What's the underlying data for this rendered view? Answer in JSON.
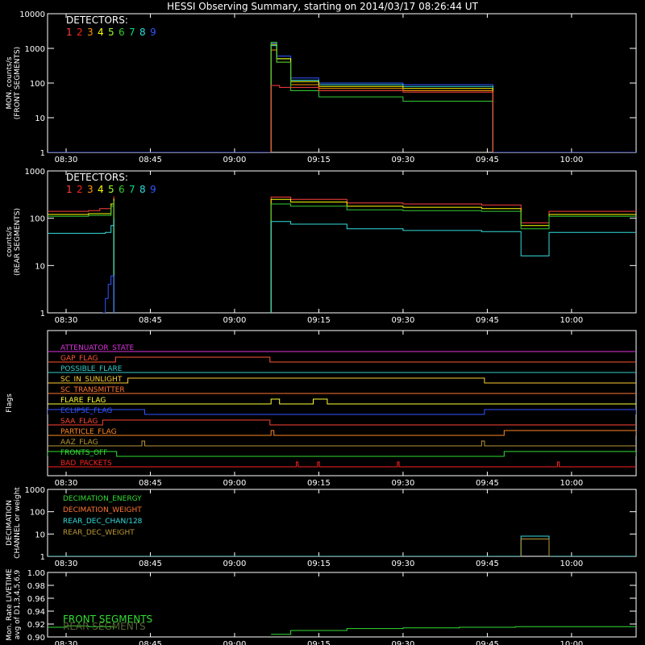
{
  "chart_data": {
    "title": "HESSI Observing Summary, starting on 2014/03/17 08:26:44 UT",
    "time_ticks": [
      "08:30",
      "08:45",
      "09:00",
      "09:15",
      "09:30",
      "09:45",
      "10:00"
    ],
    "time_tick_minutes": [
      30,
      45,
      60,
      75,
      90,
      105,
      120
    ],
    "x_range_minutes": [
      26.7,
      131.5
    ],
    "panels": [
      {
        "type": "line",
        "ylabel": [
          "MON. counts/s",
          "(FRONT SEGMENTS)"
        ],
        "yscale": "log",
        "ylim": [
          1,
          10000
        ],
        "y_tick_labels": [
          "1",
          "10",
          "100",
          "1000",
          "10000"
        ],
        "legend_title": "DETECTORS:",
        "legend_digits": [
          "1",
          "2",
          "3",
          "4",
          "5",
          "6",
          "7",
          "8",
          "9"
        ],
        "legend_colors": [
          "#ff4040",
          "#ff2020",
          "#ff9900",
          "#ffff00",
          "#99ff33",
          "#33cc33",
          "#00dd88",
          "#33dddd",
          "#3355ff"
        ],
        "series": [
          {
            "color": "#3355ff",
            "x": [
              26.7,
              66.5,
              66.5,
              67.5,
              70,
              75,
              90,
              106,
              106,
              131.5
            ],
            "y": [
              1,
              1,
              1400,
              600,
              140,
              100,
              90,
              90,
              1,
              1
            ]
          },
          {
            "color": "#33dddd",
            "x": [
              66.5,
              66.5,
              67.5,
              70,
              75,
              90,
              106,
              106
            ],
            "y": [
              1,
              1200,
              500,
              120,
              90,
              80,
              80,
              1
            ]
          },
          {
            "color": "#ffff00",
            "x": [
              66.5,
              66.5,
              67.5,
              70,
              75,
              90,
              106,
              106
            ],
            "y": [
              1,
              1300,
              500,
              110,
              80,
              70,
              70,
              1
            ]
          },
          {
            "color": "#ff9900",
            "x": [
              66.5,
              66.5,
              67.5,
              70,
              75,
              90,
              106,
              106
            ],
            "y": [
              1,
              900,
              400,
              90,
              70,
              60,
              60,
              1
            ]
          },
          {
            "color": "#33cc33",
            "x": [
              66.5,
              66.5,
              67.5,
              70,
              75,
              90,
              106,
              106
            ],
            "y": [
              1,
              1500,
              400,
              60,
              40,
              30,
              35,
              1
            ]
          },
          {
            "color": "#ff4040",
            "x": [
              66.5,
              66.5,
              68,
              75,
              90,
              106,
              106
            ],
            "y": [
              1,
              85,
              75,
              60,
              55,
              55,
              1
            ]
          }
        ]
      },
      {
        "type": "line",
        "ylabel": [
          "counts/s",
          "(REAR SEGMENTS)"
        ],
        "yscale": "log",
        "ylim": [
          1,
          1000
        ],
        "y_tick_labels": [
          "1",
          "10",
          "100",
          "1000"
        ],
        "legend_title": "DETECTORS:",
        "legend_digits": [
          "1",
          "2",
          "3",
          "4",
          "5",
          "6",
          "7",
          "8",
          "9"
        ],
        "legend_colors": [
          "#ff4040",
          "#ff2020",
          "#ff9900",
          "#ffff00",
          "#99ff33",
          "#33cc33",
          "#00dd88",
          "#33dddd",
          "#3355ff"
        ],
        "series": [
          {
            "color": "#ff4040",
            "x": [
              26.7,
              34,
              36,
              38,
              38.5,
              38.5
            ],
            "y": [
              140,
              145,
              160,
              200,
              290,
              1
            ]
          },
          {
            "color": "#ff4040",
            "x": [
              66.5,
              66.5,
              70,
              80,
              90,
              104,
              111,
              111,
              116,
              116,
              131.5
            ],
            "y": [
              1,
              280,
              250,
              210,
              200,
              190,
              180,
              80,
              80,
              140,
              140
            ]
          },
          {
            "color": "#ffff00",
            "x": [
              26.7,
              34,
              38,
              38.5,
              38.5
            ],
            "y": [
              120,
              125,
              200,
              260,
              1
            ]
          },
          {
            "color": "#ffff00",
            "x": [
              66.5,
              66.5,
              70,
              80,
              90,
              104,
              111,
              111,
              116,
              116,
              131.5
            ],
            "y": [
              1,
              250,
              220,
              180,
              170,
              160,
              160,
              70,
              70,
              120,
              120
            ]
          },
          {
            "color": "#33cc33",
            "x": [
              26.7,
              34,
              38,
              38.5,
              38.5
            ],
            "y": [
              110,
              115,
              180,
              230,
              1
            ]
          },
          {
            "color": "#33cc33",
            "x": [
              66.5,
              66.5,
              70,
              80,
              90,
              104,
              111,
              111,
              116,
              116,
              131.5
            ],
            "y": [
              1,
              200,
              180,
              150,
              145,
              140,
              140,
              60,
              60,
              110,
              110
            ]
          },
          {
            "color": "#33dddd",
            "x": [
              26.7,
              37,
              38,
              38.5,
              38.5
            ],
            "y": [
              48,
              50,
              70,
              100,
              1
            ]
          },
          {
            "color": "#33dddd",
            "x": [
              66.5,
              66.5,
              70,
              80,
              90,
              104,
              111,
              111,
              116,
              116,
              131.5
            ],
            "y": [
              1,
              85,
              75,
              60,
              55,
              52,
              52,
              16,
              16,
              50,
              50
            ]
          },
          {
            "color": "#3355ff",
            "x": [
              36.5,
              37,
              37.5,
              38,
              38.5
            ],
            "y": [
              1,
              2,
              4,
              6,
              1
            ]
          }
        ]
      },
      {
        "type": "flags",
        "ylabel": [
          "Flags"
        ],
        "flags": [
          {
            "name": "ATTENUATOR_STATE",
            "color": "#dd33dd",
            "segments": []
          },
          {
            "name": "GAP_FLAG",
            "color": "#ff5533",
            "segments": [
              [
                38.8,
                66.3
              ]
            ]
          },
          {
            "name": "POSSIBLE_FLARE",
            "color": "#33cccc",
            "segments": []
          },
          {
            "name": "SC_IN_SUNLIGHT",
            "color": "#ffcc33",
            "segments": [
              [
                41,
                104.5
              ]
            ]
          },
          {
            "name": "SC_TRANSMITTER",
            "color": "#ff7733",
            "segments": []
          },
          {
            "name": "FLARE_FLAG",
            "color": "#ffff33",
            "segments": [
              [
                66.5,
                68
              ],
              [
                74,
                76.5
              ]
            ]
          },
          {
            "name": "ECLIPSE_FLAG",
            "color": "#3355ff",
            "segments": [
              [
                26.7,
                44
              ],
              [
                104.5,
                131.5
              ]
            ]
          },
          {
            "name": "SAA_FLAG",
            "color": "#ff4433",
            "segments": [
              [
                36.5,
                66.3
              ]
            ]
          },
          {
            "name": "PARTICLE_FLAG",
            "color": "#ff8822",
            "segments": [
              [
                66.5,
                67
              ],
              [
                108,
                131.5
              ]
            ]
          },
          {
            "name": "AAZ_FLAG",
            "color": "#bb9933",
            "segments": [
              [
                43.5,
                44
              ],
              [
                104,
                104.5
              ]
            ]
          },
          {
            "name": "FRONTS_OFF",
            "color": "#33dd33",
            "segments": [
              [
                26.7,
                39
              ],
              [
                108,
                131.5
              ]
            ]
          },
          {
            "name": "BAD_PACKETS",
            "color": "#ff2222",
            "segments": [
              [
                71,
                71.3
              ],
              [
                74.8,
                75.1
              ],
              [
                89,
                89.3
              ],
              [
                117.5,
                117.8
              ]
            ]
          }
        ]
      },
      {
        "type": "line",
        "ylabel": [
          "DECIMATION",
          "CHANNEL or weight"
        ],
        "yscale": "log",
        "ylim": [
          1,
          1000
        ],
        "y_tick_labels": [
          "1",
          "10",
          "100",
          "1000"
        ],
        "legend": [
          {
            "name": "DECIMATION_ENERGY",
            "color": "#33dd33"
          },
          {
            "name": "DECIMATION_WEIGHT",
            "color": "#ff7733"
          },
          {
            "name": "REAR_DEC_CHAN/128",
            "color": "#33dddd"
          },
          {
            "name": "REAR_DEC_WEIGHT",
            "color": "#bb9933"
          }
        ],
        "series": [
          {
            "color": "#33dddd",
            "x": [
              26.7,
              111,
              111,
              116,
              116,
              131.5
            ],
            "y": [
              1,
              1,
              8,
              8,
              1,
              1
            ]
          },
          {
            "color": "#bb9933",
            "x": [
              111,
              111,
              116,
              116
            ],
            "y": [
              1,
              6,
              6,
              1
            ]
          }
        ]
      },
      {
        "type": "line",
        "ylabel": [
          "Mon. Rate LIVETIME",
          "avg of D1,3,4,5,6,9"
        ],
        "yscale": "linear",
        "ylim": [
          0.9,
          1.0
        ],
        "y_tick_labels": [
          "0.90",
          "0.92",
          "0.94",
          "0.96",
          "0.98",
          "1.00"
        ],
        "legend": [
          {
            "name": "FRONT SEGMENTS",
            "color": "#33dd33"
          },
          {
            "name": "REAR SEGMENTS",
            "color": "#556633"
          }
        ],
        "series": [
          {
            "color": "#33dd33",
            "x": [
              26.7,
              30,
              34,
              37,
              38.5
            ],
            "y": [
              0.915,
              0.917,
              0.916,
              0.916,
              0.913
            ]
          },
          {
            "color": "#33dd33",
            "x": [
              66.5,
              70,
              80,
              90,
              100,
              110,
              120,
              131.5
            ],
            "y": [
              0.904,
              0.91,
              0.913,
              0.914,
              0.915,
              0.916,
              0.916,
              0.917
            ]
          }
        ]
      }
    ]
  }
}
